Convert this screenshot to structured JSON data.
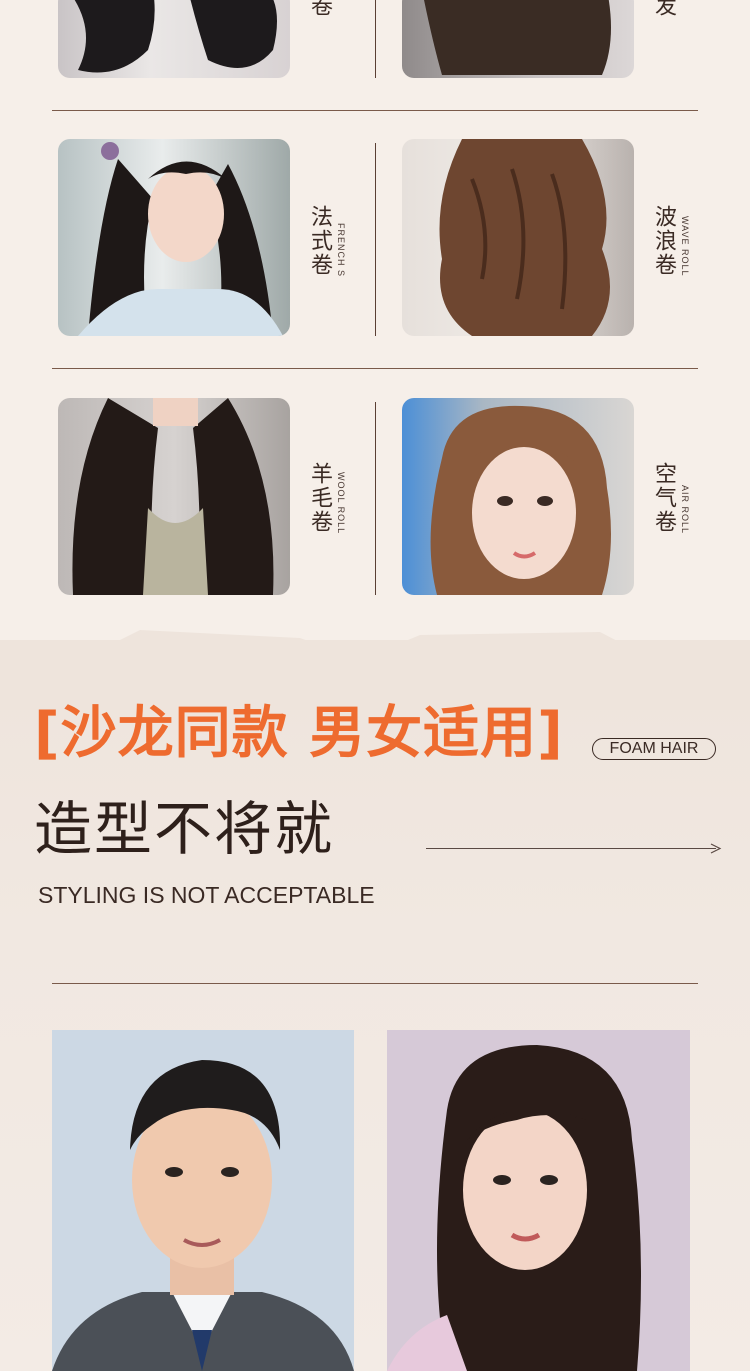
{
  "hairstyles": [
    {
      "cn": "法式卷",
      "en": "FRENCH S"
    },
    {
      "cn": "波浪卷",
      "en": "WAVE ROLL"
    },
    {
      "cn": "羊毛卷",
      "en": "WOOL ROLL"
    },
    {
      "cn": "空气卷",
      "en": "AIR ROLL"
    }
  ],
  "top_partial": {
    "left_cn": "卷",
    "right_cn": "发"
  },
  "promo": {
    "headline": "[沙龙同款 男女适用]",
    "badge": "FOAM HAIR",
    "subtitle": "造型不将就",
    "tagline": "STYLING IS NOT ACCEPTABLE"
  },
  "colors": {
    "accent": "#ee6b2f",
    "text_dark": "#2e201b",
    "bg": "#f6efe9"
  }
}
